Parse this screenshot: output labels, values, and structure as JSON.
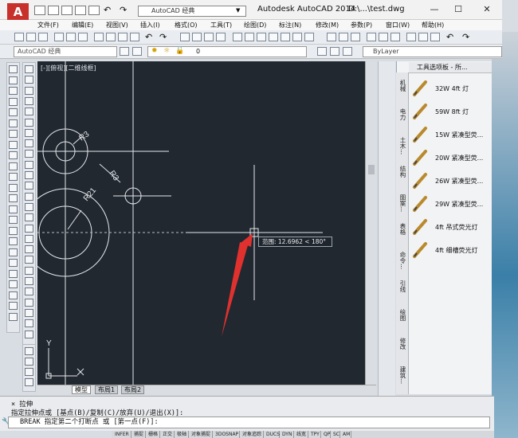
{
  "titlebar": {
    "logo": "A",
    "workspace": "AutoCAD 经典",
    "app_title": "Autodesk AutoCAD 2014",
    "file_title": "D:\\...\\test.dwg",
    "minimize": "—",
    "maximize": "☐",
    "close": "✕"
  },
  "menus": [
    "文件(F)",
    "编辑(E)",
    "视图(V)",
    "插入(I)",
    "格式(O)",
    "工具(T)",
    "绘图(D)",
    "标注(N)",
    "修改(M)",
    "参数(P)",
    "窗口(W)",
    "帮助(H)"
  ],
  "toolbar2": {
    "workspace": "AutoCAD 经典",
    "layer": "0",
    "linetype": "ByLayer"
  },
  "drawing": {
    "view_label": "[-][俯视][二维线框]",
    "dims": {
      "r3a": "R3",
      "r3b": "R3",
      "r21": "R21"
    },
    "axis_y": "Y",
    "tooltip": "范围: 12.6962 < 180°"
  },
  "tabs": [
    "模型",
    "布局1",
    "布局2"
  ],
  "palette": {
    "title": "工具选项板 - 所...",
    "items": [
      "32W 4ft 灯",
      "59W 8ft 灯",
      "15W 紧凑型荧...",
      "20W 紧凑型荧...",
      "26W 紧凑型荧...",
      "29W 紧凑型荧...",
      "4ft 吊式荧光灯",
      "4ft 细槽荧光灯"
    ],
    "side_tabs": [
      "机械",
      "电力",
      "土木...",
      "结构",
      "图案...",
      "表格",
      "命令...",
      "引线",
      "绘图",
      "修改",
      "建筑..."
    ]
  },
  "command": {
    "line1": "× 拉伸",
    "line2": "指定拉伸点或 [基点(B)/复制(C)/放弃(U)/退出(X)]:",
    "input": "BREAK 指定第二个打断点 或 [第一点(F)]:"
  },
  "status": [
    "INFER",
    "捕捉",
    "栅格",
    "正交",
    "极轴",
    "对象捕捉",
    "3DOSNAP",
    "对象追踪",
    "DUCS",
    "DYN",
    "线宽",
    "TPY",
    "QP",
    "SC",
    "AM"
  ]
}
